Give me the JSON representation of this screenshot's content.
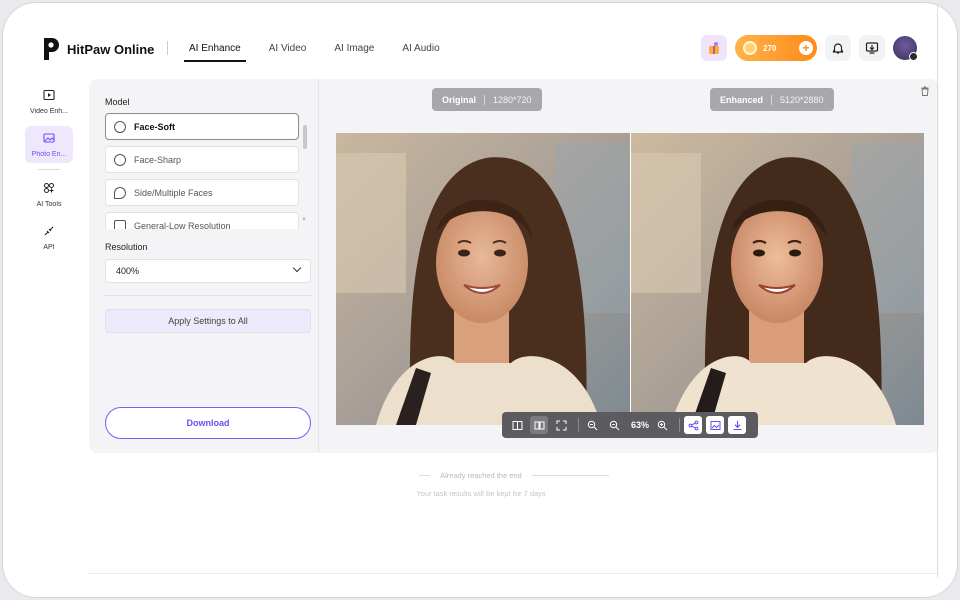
{
  "brand": {
    "name": "HitPaw Online"
  },
  "nav": {
    "items": [
      {
        "label": "AI Enhance",
        "active": true
      },
      {
        "label": "AI Video",
        "active": false
      },
      {
        "label": "AI Image",
        "active": false
      },
      {
        "label": "AI Audio",
        "active": false
      }
    ]
  },
  "header": {
    "credits": "270"
  },
  "rail": {
    "items": [
      {
        "label": "Video Enh...",
        "icon": "video-enhance-icon",
        "active": false
      },
      {
        "label": "Photo En...",
        "icon": "photo-enhance-icon",
        "active": true
      },
      {
        "label": "AI Tools",
        "icon": "ai-tools-icon",
        "active": false
      },
      {
        "label": "API",
        "icon": "api-icon",
        "active": false
      }
    ]
  },
  "settings": {
    "model_label": "Model",
    "models": [
      {
        "label": "Face-Soft",
        "selected": true
      },
      {
        "label": "Face-Sharp",
        "selected": false
      },
      {
        "label": "Side/Multiple Faces",
        "selected": false
      },
      {
        "label": "General-Low Resolution",
        "selected": false
      }
    ],
    "resolution_label": "Resolution",
    "resolution_value": "400%",
    "apply_label": "Apply Settings to All",
    "download_label": "Download"
  },
  "preview": {
    "original_label": "Original",
    "original_res": "1280*720",
    "enhanced_label": "Enhanced",
    "enhanced_res": "5120*2880",
    "zoom": "63%"
  },
  "footer": {
    "end_text": "Already reached the end",
    "keep_text": "Your task results will be kept for 7 days"
  },
  "colors": {
    "accent": "#6b4ef0",
    "credits": "#ff8a1a"
  }
}
